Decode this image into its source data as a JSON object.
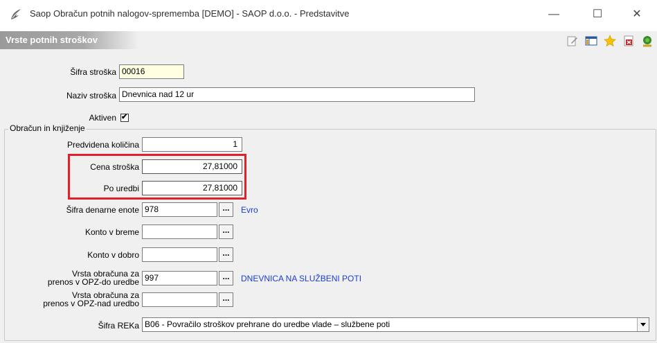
{
  "window": {
    "title": "Saop Obračun potnih nalogov-sprememba [DEMO] - SAOP d.o.o. - Predstavitve",
    "minimize": "—",
    "maximize": "☐",
    "close": "✕"
  },
  "header": {
    "title": "Vrste potnih stroškov",
    "toolbar": [
      "edit-icon",
      "table-icon",
      "star-icon",
      "delete-icon",
      "exit-icon"
    ]
  },
  "form": {
    "sifra_label": "Šifra stroška",
    "sifra_value": "00016",
    "naziv_label": "Naziv stroška",
    "naziv_value": "Dnevnica nad 12 ur",
    "aktiven_label": "Aktiven",
    "aktiven_checked": "✔",
    "group_title": "Obračun in knjiženje",
    "kolicina_label": "Predvidena količina",
    "kolicina_value": "1",
    "cena_label": "Cena stroška",
    "cena_value": "27,81000",
    "uredbi_label": "Po uredbi",
    "uredbi_value": "27,81000",
    "denarna_label": "Šifra denarne enote",
    "denarna_value": "978",
    "denarna_desc": "Evro",
    "breme_label": "Konto v breme",
    "breme_value": "",
    "dobro_label": "Konto v dobro",
    "dobro_value": "",
    "opz_do_label_1": "Vrsta obračuna za",
    "opz_do_label_2": "prenos v OPZ-do uredbe",
    "opz_do_value": "997",
    "opz_do_desc": "DNEVNICA NA SLUŽBENI POTI",
    "opz_nad_label_1": "Vrsta obračuna za",
    "opz_nad_label_2": "prenos v OPZ-nad uredbo",
    "opz_nad_value": "",
    "reka_label": "Šifra REKa",
    "reka_value": "B06 - Povračilo stroškov prehrane do uredbe vlade – službene poti",
    "dots": "..."
  }
}
